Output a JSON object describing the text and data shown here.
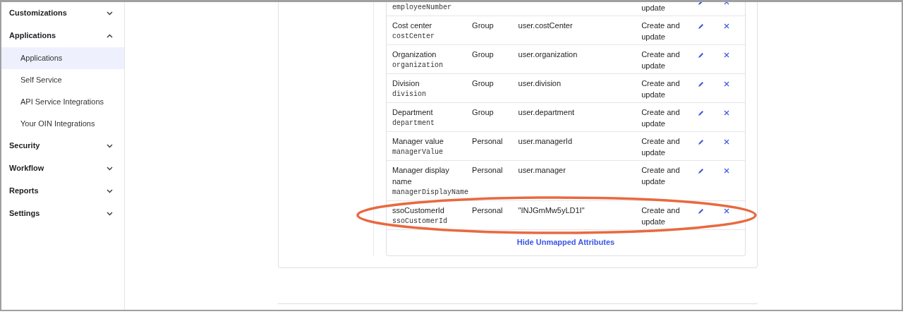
{
  "sidebar": {
    "groups": [
      {
        "label": "Customizations",
        "expanded": false
      },
      {
        "label": "Applications",
        "expanded": true,
        "items": [
          {
            "label": "Applications",
            "selected": true
          },
          {
            "label": "Self Service",
            "selected": false
          },
          {
            "label": "API Service Integrations",
            "selected": false
          },
          {
            "label": "Your OIN Integrations",
            "selected": false
          }
        ]
      },
      {
        "label": "Security",
        "expanded": false
      },
      {
        "label": "Workflow",
        "expanded": false
      },
      {
        "label": "Reports",
        "expanded": false
      },
      {
        "label": "Settings",
        "expanded": false
      }
    ]
  },
  "attributes_table": {
    "rows": [
      {
        "display_name": "",
        "variable": "employeeNumber",
        "type": "",
        "value": "",
        "apply_on": "update",
        "highlighted": false
      },
      {
        "display_name": "Cost center",
        "variable": "costCenter",
        "type": "Group",
        "value": "user.costCenter",
        "apply_on": "Create and update",
        "highlighted": false
      },
      {
        "display_name": "Organization",
        "variable": "organization",
        "type": "Group",
        "value": "user.organization",
        "apply_on": "Create and update",
        "highlighted": false
      },
      {
        "display_name": "Division",
        "variable": "division",
        "type": "Group",
        "value": "user.division",
        "apply_on": "Create and update",
        "highlighted": false
      },
      {
        "display_name": "Department",
        "variable": "department",
        "type": "Group",
        "value": "user.department",
        "apply_on": "Create and update",
        "highlighted": false
      },
      {
        "display_name": "Manager value",
        "variable": "managerValue",
        "type": "Personal",
        "value": "user.managerId",
        "apply_on": "Create and update",
        "highlighted": false
      },
      {
        "display_name": "Manager display name",
        "variable": "managerDisplayName",
        "type": "Personal",
        "value": "user.manager",
        "apply_on": "Create and update",
        "highlighted": false
      },
      {
        "display_name": "ssoCustomerId",
        "variable": "ssoCustomerId",
        "type": "Personal",
        "value": "\"INJGmMw5yLD1I\"",
        "apply_on": "Create and update",
        "highlighted": true
      }
    ],
    "toggle_link": "Hide Unmapped Attributes"
  }
}
